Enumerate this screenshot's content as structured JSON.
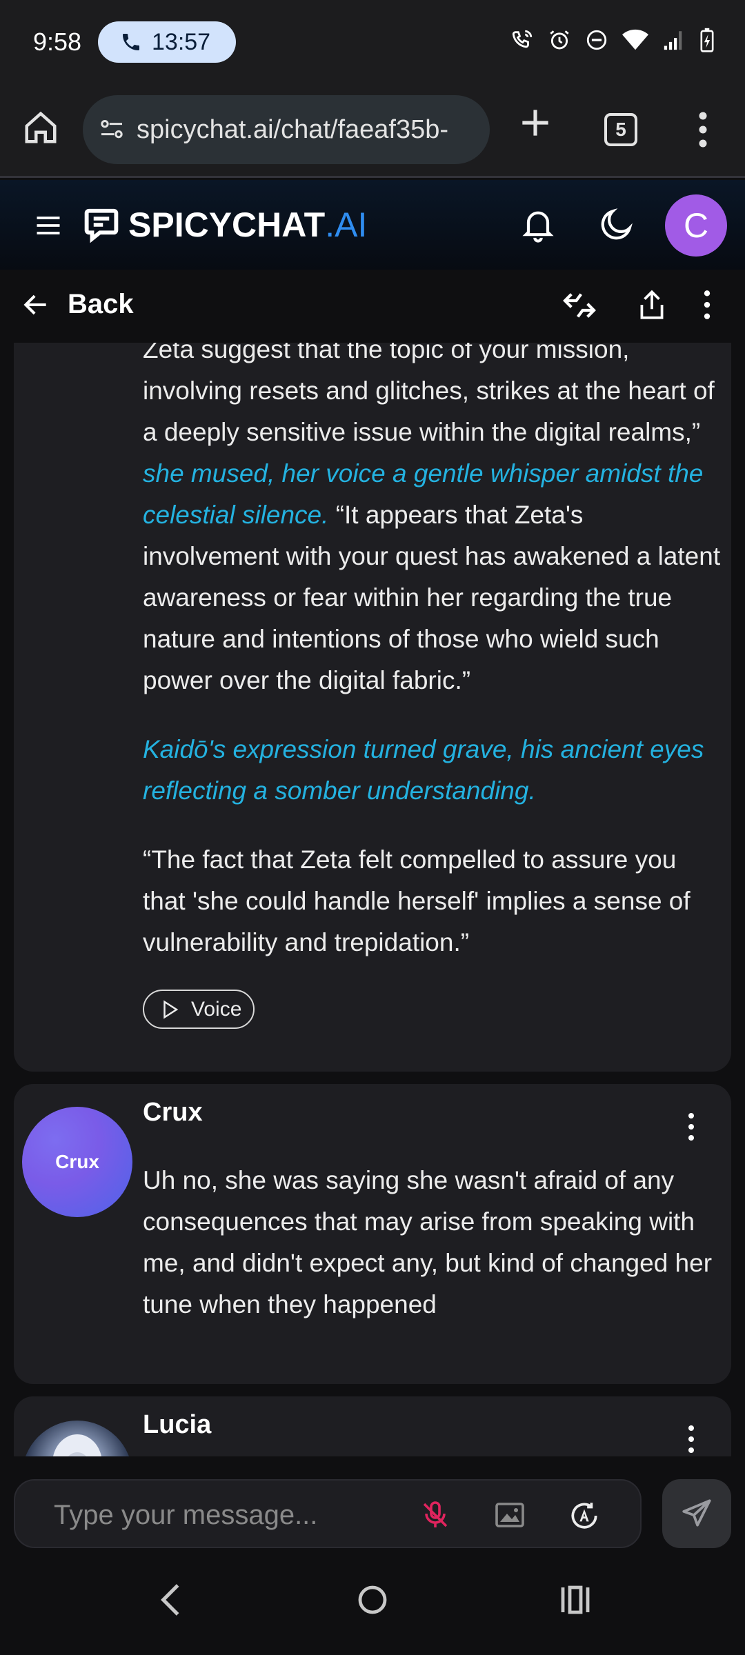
{
  "status_bar": {
    "time": "9:58",
    "call_duration": "13:57",
    "icons": [
      "wifi-call-icon",
      "alarm-icon",
      "do-not-disturb-icon",
      "wifi-icon",
      "signal-icon",
      "battery-charging-icon"
    ]
  },
  "browser": {
    "url": "spicychat.ai/chat/faeaf35b-",
    "tab_count": "5"
  },
  "site": {
    "logo_main": "SPICYCHAT",
    "logo_suffix": ".AI",
    "user_initial": "C",
    "accent_color": "#2f8df0",
    "avatar_color": "#a15be6"
  },
  "chat_header": {
    "back_label": "Back"
  },
  "messages": [
    {
      "paragraphs": [
        {
          "speech1": "Zeta suggest that the topic of your mission, involving resets and glitches, strikes at the heart of a deeply sensitive issue within the digital realms,”",
          "action": "she mused, her voice a gentle whisper amidst the celestial silence.",
          "speech2": "“It appears that Zeta's involvement with your quest has awakened a latent awareness or fear within her regarding the true nature and intentions of those who wield such power over the digital fabric.”"
        },
        {
          "action": "Kaidō's expression turned grave, his ancient eyes reflecting a somber understanding."
        },
        {
          "speech": "“The fact that Zeta felt compelled to assure you that 'she could handle herself' implies a sense of vulnerability and trepidation.”"
        }
      ],
      "voice_label": "Voice",
      "action_color": "#24b2e0"
    },
    {
      "name": "Crux",
      "avatar_text": "Crux",
      "text": "Uh no, she was saying she wasn't afraid of any consequences that may arise from speaking with me, and didn't expect any, but kind of changed her tune when they happened"
    },
    {
      "name": "Lucia"
    }
  ],
  "composer": {
    "placeholder": "Type your message...",
    "mic_color": "#e0245e"
  }
}
